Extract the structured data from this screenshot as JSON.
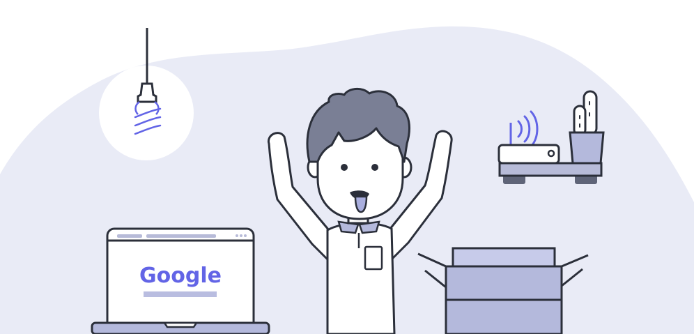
{
  "illustration": {
    "laptop_screen": {
      "logo_text": "Google"
    },
    "icons": [
      "light-bulb-icon",
      "wifi-router-icon",
      "cactus-plant-icon",
      "laptop-icon",
      "open-box-icon"
    ]
  },
  "colors": {
    "background_blob": "#e9ebf6",
    "outline": "#2b2f3a",
    "accent_purple": "#6264e6",
    "hair": "#7a7f95",
    "box_fill": "#b4b9dc",
    "box_fill_light": "#c7cbea",
    "shelf": "#b7bbd8",
    "shelf_feet": "#5f6478",
    "search_bar": "#b9bde0",
    "tongue": "#a9aede",
    "white": "#ffffff"
  }
}
